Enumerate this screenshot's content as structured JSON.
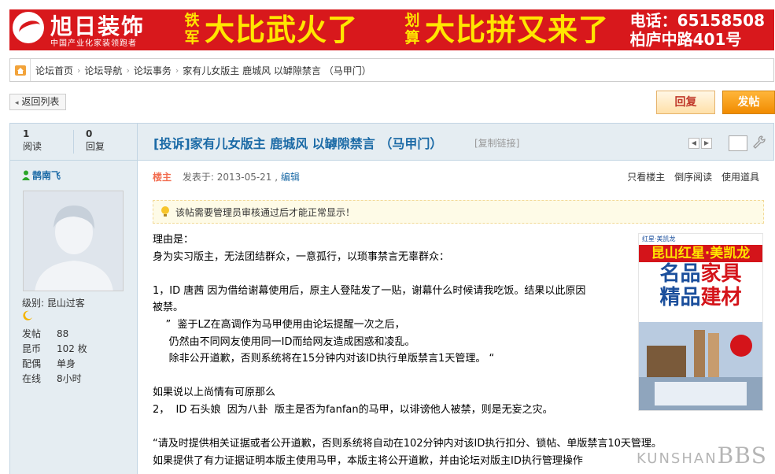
{
  "banner": {
    "logo_title": "旭日装饰",
    "logo_sub": "中国产业化家装领跑者",
    "tag1": "铁军",
    "slogan1": "大比武火了",
    "tag2": "划算",
    "slogan2": "大比拼又来了",
    "phone": "电话：65158508",
    "address": "柏庐中路401号",
    "brand_color": "#d8181c"
  },
  "breadcrumb": {
    "items": [
      "论坛首页",
      "论坛导航",
      "论坛事务",
      "家有儿女版主 鹿城风 以罅隙禁言 （马甲门）"
    ]
  },
  "actions": {
    "back": "返回列表",
    "reply": "回复",
    "post": "发帖"
  },
  "thread": {
    "views": "1",
    "views_label": "阅读",
    "replies": "0",
    "replies_label": "回复",
    "title": "[投诉]家有儿女版主  鹿城风  以罅隙禁言  （马甲门）",
    "copy_link": "[复制链接]"
  },
  "user": {
    "name": "鹊南飞",
    "level": "级别: 昆山过客",
    "stats": [
      {
        "k": "发帖",
        "v": "88"
      },
      {
        "k": "昆币",
        "v": "102 枚"
      },
      {
        "k": "配偶",
        "v": "单身"
      },
      {
        "k": "在线",
        "v": "8小时"
      }
    ]
  },
  "post": {
    "author_tag": "楼主",
    "posted": "发表于: 2013-05-21 ,",
    "edit": "编辑",
    "tools": [
      "只看楼主",
      "倒序阅读",
      "使用道具"
    ],
    "notice": "该帖需要管理员审核通过后才能正常显示！",
    "lines": [
      "理由是：",
      "身为实习版主，无法团结群众，一意孤行，以琐事禁言无辜群众：",
      "",
      "1，ID 唐茜  因为借给谢幕使用后，原主人登陆发了一贴，谢幕什么时候请我吃饭。结果以此原因",
      "被禁。",
      "    ”  鉴于LZ在高调作为马甲使用由论坛提醒一次之后，",
      "     仍然由不同网友使用同一ID而给网友造成困惑和凌乱。",
      "     除非公开道歉，否则系统将在15分钟内对该ID执行单版禁言1天管理。 “",
      "",
      "如果说以上尚情有可原那么",
      "2，  ID 石头娘  因为八卦  版主是否为fanfan的马甲，以诽谤他人被禁，则是无妄之灾。",
      "",
      "“请及时提供相关证据或者公开道歉，否则系统将自动在102分钟内对该ID执行扣分、锁帖、单版禁言10天管理。",
      "如果提供了有力证据证明本版主使用马甲，本版主将公开道歉，并由论坛对版主ID执行管理操作"
    ]
  },
  "ad": {
    "top": "红星·美凯龙",
    "band": "昆山红星·美凯龙",
    "line1a": "名品",
    "line1b": "家具",
    "line2a": "精品",
    "line2b": "建材"
  },
  "watermark": {
    "small": "KUNSHAN",
    "big": "BBS"
  }
}
